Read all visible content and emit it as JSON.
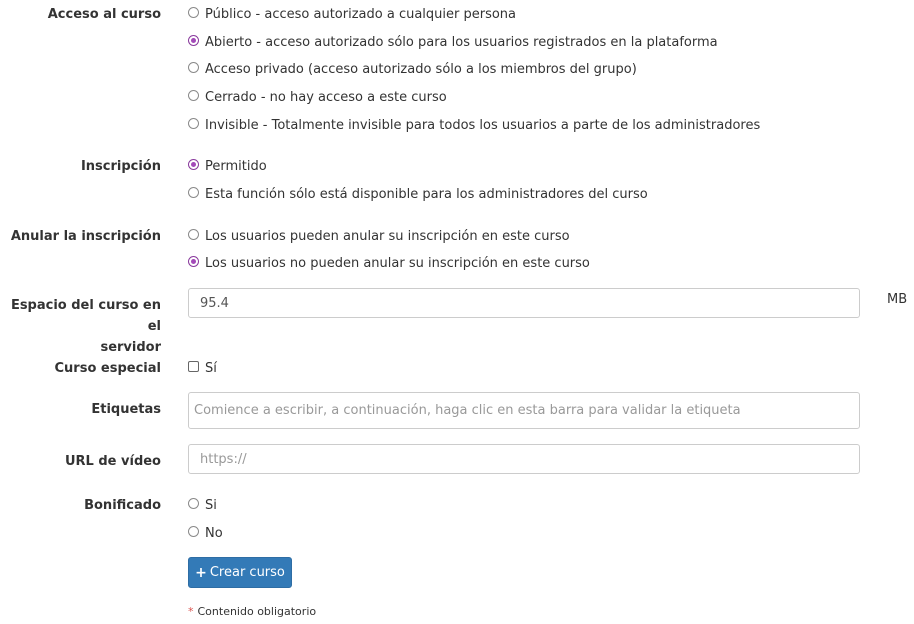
{
  "acceso": {
    "label": "Acceso al curso",
    "options": [
      "Público - acceso autorizado a cualquier persona",
      "Abierto - acceso autorizado sólo para los usuarios registrados en la plataforma",
      "Acceso privado (acceso autorizado sólo a los miembros del grupo)",
      "Cerrado - no hay acceso a este curso",
      "Invisible - Totalmente invisible para todos los usuarios a parte de los administradores"
    ],
    "selected": 1
  },
  "inscripcion": {
    "label": "Inscripción",
    "options": [
      "Permitido",
      "Esta función sólo está disponible para los administradores del curso"
    ],
    "selected": 0
  },
  "anular": {
    "label": "Anular la inscripción",
    "options": [
      "Los usuarios pueden anular su inscripción en este curso",
      "Los usuarios no pueden anular su inscripción en este curso"
    ],
    "selected": 1
  },
  "espacio": {
    "label_line1": "Espacio del curso en el",
    "label_line2": "servidor",
    "value": "95.4",
    "unit": "MB"
  },
  "especial": {
    "label": "Curso especial",
    "checkbox_label": "Sí",
    "checked": false
  },
  "etiquetas": {
    "label": "Etiquetas",
    "placeholder": "Comience a escribir, a continuación, haga clic en esta barra para validar la etiqueta"
  },
  "url_video": {
    "label": "URL de vídeo",
    "placeholder": "https://"
  },
  "bonificado": {
    "label": "Bonificado",
    "options": [
      "Si",
      "No"
    ],
    "selected": -1
  },
  "submit": {
    "label": "Crear curso"
  },
  "required_note": {
    "star": "*",
    "text": "Contenido obligatorio"
  },
  "colors": {
    "accent": "#a349b8",
    "button": "#337ab7",
    "required": "#d9534f"
  }
}
